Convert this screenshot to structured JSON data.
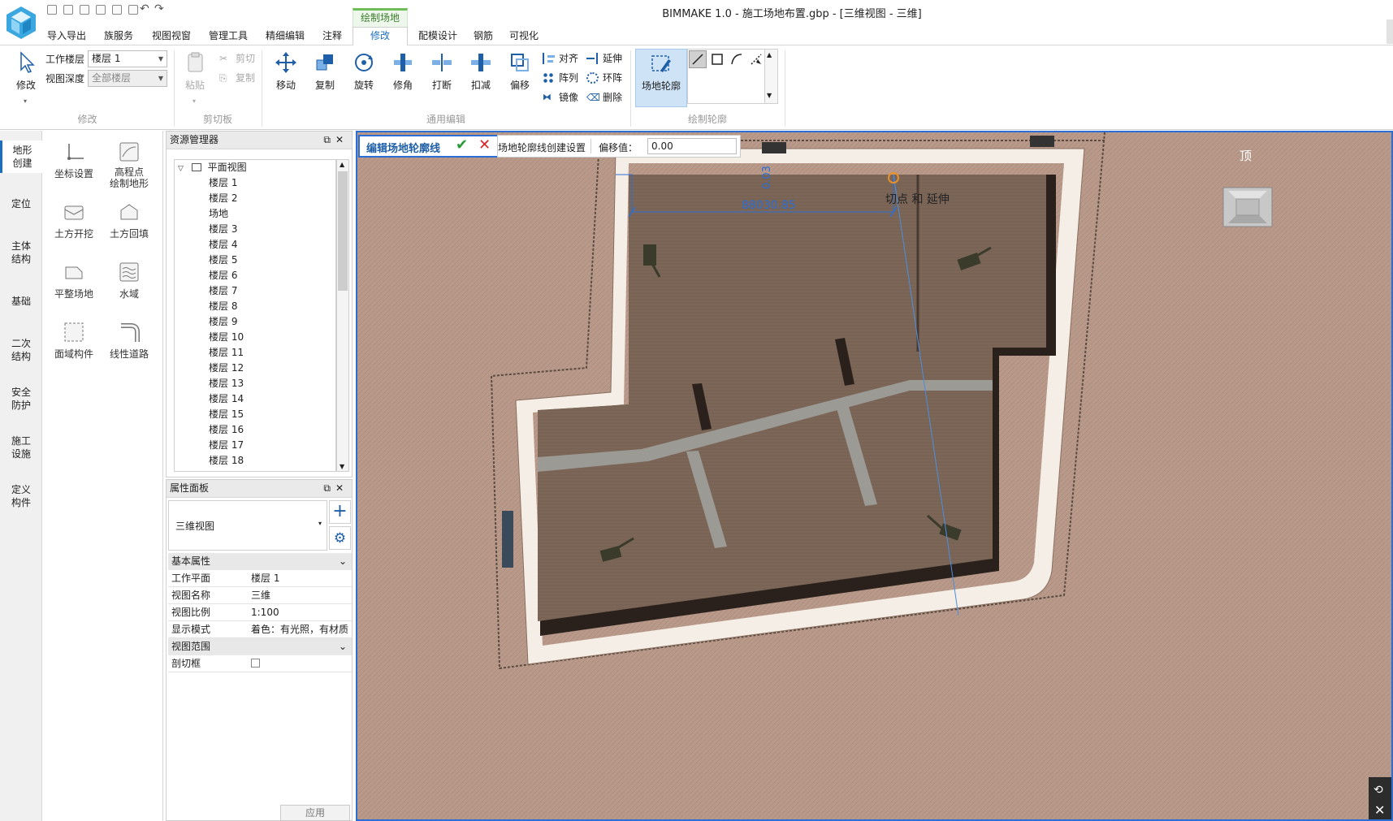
{
  "window": {
    "title": "BIMMAKE 1.0 - 施工场地布置.gbp - [三维视图 - 三维]"
  },
  "menu_tabs": [
    "导入导出",
    "族服务",
    "视图视窗",
    "管理工具",
    "精细编辑",
    "注释",
    "修改",
    "配模设计",
    "钢筋",
    "可视化"
  ],
  "context_tab_group": "绘制场地",
  "ribbon": {
    "modify": {
      "label": "修改",
      "group": "修改",
      "work_floor_label": "工作楼层",
      "work_floor_value": "楼层 1",
      "view_depth_label": "视图深度",
      "view_depth_value": "全部楼层"
    },
    "clipboard": {
      "group": "剪切板",
      "paste": "粘贴",
      "cut": "剪切",
      "copy": "复制"
    },
    "edit": {
      "group": "通用编辑",
      "move": "移动",
      "copy": "复制",
      "rotate": "旋转",
      "trim": "修角",
      "break": "打断",
      "subtract": "扣减",
      "offset": "偏移",
      "align": "对齐",
      "array": "阵列",
      "mirror": "镜像",
      "extend": "延伸",
      "ring": "环阵",
      "delete": "删除"
    },
    "draw": {
      "group": "绘制轮廓",
      "site_outline": "场地轮廓"
    }
  },
  "left_rail": [
    "地形\n创建",
    "定位",
    "主体\n结构",
    "基础",
    "二次\n结构",
    "安全\n防护",
    "施工\n设施",
    "定义\n构件"
  ],
  "tools": [
    {
      "label": "坐标设置",
      "icon": "axis-icon"
    },
    {
      "label": "高程点\n绘制地形",
      "icon": "elevation-icon"
    },
    {
      "label": "土方开挖",
      "icon": "excavation-icon"
    },
    {
      "label": "土方回填",
      "icon": "backfill-icon"
    },
    {
      "label": "平整场地",
      "icon": "leveling-icon"
    },
    {
      "label": "水域",
      "icon": "water-icon"
    },
    {
      "label": "面域构件",
      "icon": "area-icon"
    },
    {
      "label": "线性道路",
      "icon": "road-icon"
    }
  ],
  "resource_panel": {
    "title": "资源管理器",
    "root": "平面视图",
    "items": [
      "楼层 1",
      "楼层 2",
      "场地",
      "楼层 3",
      "楼层 4",
      "楼层 5",
      "楼层 6",
      "楼层 7",
      "楼层 8",
      "楼层 9",
      "楼层 10",
      "楼层 11",
      "楼层 12",
      "楼层 13",
      "楼层 14",
      "楼层 15",
      "楼层 16",
      "楼层 17",
      "楼层 18"
    ]
  },
  "property_panel": {
    "title": "属性面板",
    "selector": "三维视图",
    "sections": [
      {
        "name": "基本属性",
        "rows": [
          [
            "工作平面",
            "楼层 1"
          ],
          [
            "视图名称",
            "三维"
          ],
          [
            "视图比例",
            "1:100"
          ],
          [
            "显示模式",
            "着色：有光照，有材质"
          ]
        ]
      },
      {
        "name": "视图范围",
        "rows": [
          [
            "剖切框",
            ""
          ]
        ]
      }
    ],
    "apply": "应用"
  },
  "viewport": {
    "edit_title": "编辑场地轮廓线",
    "outline_setting": "场地轮廓线创建设置",
    "offset_label": "偏移值：",
    "offset_value": "0.00",
    "dim_value": "88030.85",
    "dim_small": "0.03",
    "snap_hint": "切点 和 延伸",
    "view_cube_label": "顶"
  },
  "colors": {
    "accent": "#2b6fd6",
    "ground": "#b99a86",
    "pit": "#7a6658",
    "road": "#f3ede4",
    "green": "#6fbd5a"
  }
}
